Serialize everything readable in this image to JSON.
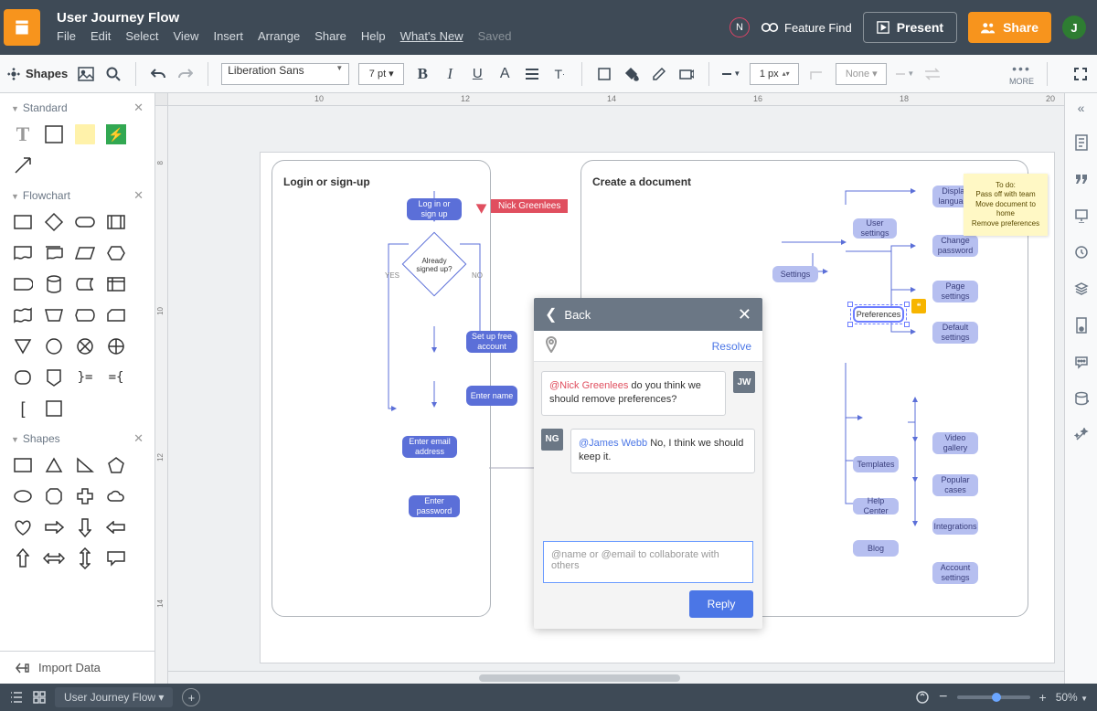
{
  "header": {
    "title": "User Journey Flow",
    "menu": [
      "File",
      "Edit",
      "Select",
      "View",
      "Insert",
      "Arrange",
      "Share",
      "Help"
    ],
    "whats_new": "What's New",
    "saved": "Saved",
    "notif": "N",
    "feature_find": "Feature Find",
    "present": "Present",
    "share": "Share",
    "avatar": "J"
  },
  "toolbar": {
    "shapes": "Shapes",
    "font": "Liberation Sans",
    "font_size": "7 pt ▾",
    "stroke": "1 px",
    "none": "None ▾",
    "more": "MORE"
  },
  "ruler_top": [
    "10",
    "12",
    "14",
    "16",
    "18",
    "20"
  ],
  "ruler_left": [
    "8",
    "10",
    "12",
    "14"
  ],
  "left": {
    "standard": "Standard",
    "flowchart": "Flowchart",
    "shapes": "Shapes",
    "import": "Import Data"
  },
  "flow": {
    "container1_title": "Login or sign-up",
    "container2_title": "Create a document",
    "login": "Log in or\nsign up",
    "already": "Already\nsigned up?",
    "yes": "YES",
    "no": "NO",
    "setup": "Set up free\naccount",
    "enter_name": "Enter name",
    "enter_email": "Enter email\naddress",
    "enter_pw": "Enter\npassword",
    "settings": "Settings",
    "user_sett": "User\nsettings",
    "display_lang": "Display\nlanguage",
    "change_pw": "Change\npassword",
    "page_sett": "Page\nsettings",
    "prefs": "Preferences",
    "default_sett": "Default\nsettings",
    "templates": "Templates",
    "help_center": "Help Center",
    "blog": "Blog",
    "video": "Video\ngallery",
    "popular": "Popular\ncases",
    "integrations": "Integrations",
    "account_sett": "Account\nsettings"
  },
  "sticky": {
    "text": "To do:\nPass off with team\nMove document to home\nRemove preferences"
  },
  "cursor_name": "Nick Greenlees",
  "comments": {
    "back": "Back",
    "resolve": "Resolve",
    "msg1_mention": "@Nick Greenlees",
    "msg1_text": " do you think we should remove preferences?",
    "msg1_avatar": "JW",
    "msg2_mention": "@James Webb",
    "msg2_text": " No, I think we should keep it.",
    "msg2_avatar": "NG",
    "placeholder": "@name or @email to collaborate with others",
    "reply": "Reply"
  },
  "bottom": {
    "page": "User Journey Flow ▾",
    "zoom_pct": "50%",
    "plus": "+",
    "minus": "−"
  }
}
